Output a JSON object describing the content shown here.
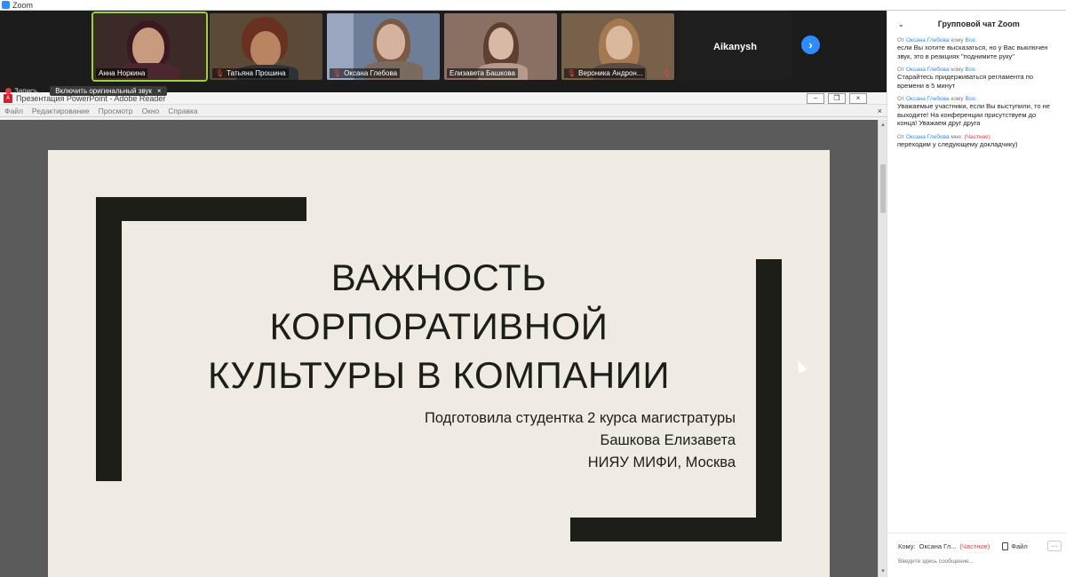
{
  "window": {
    "title": "Zoom"
  },
  "participants": [
    {
      "name": "Анна Норкина",
      "muted": false,
      "skin": "#c89a7e",
      "hair": "#3a1a22",
      "bg": "#3b2a26"
    },
    {
      "name": "Татьяна Прошина",
      "muted": true,
      "skin": "#b98462",
      "hair": "#6a3120",
      "bg": "#5b4a38"
    },
    {
      "name": "Оксана Глебова",
      "muted": true,
      "skin": "#d5b2a0",
      "hair": "#7a5a44",
      "bg": "#6f7e98"
    },
    {
      "name": "Елизавета Башкова",
      "muted": false,
      "skin": "#d8b9a6",
      "hair": "#5e4030",
      "bg": "#8a6f63"
    },
    {
      "name": "Вероника Андрон...",
      "muted": true,
      "skin": "#d9b89e",
      "hair": "#a47850",
      "bg": "#77614a"
    },
    {
      "name": "Aikanysh",
      "muted": false,
      "text_only": true
    }
  ],
  "recording": {
    "label": "Запись"
  },
  "audio_tip": {
    "label": "Включить оригинальный звук",
    "close": "×"
  },
  "reader": {
    "title": "Презентация PowerPoint - Adobe Reader",
    "menu": [
      "Файл",
      "Редактирование",
      "Просмотр",
      "Окно",
      "Справка"
    ],
    "close_doc": "×",
    "buttons": {
      "minimize": "‒",
      "restore": "❐",
      "close": "×"
    }
  },
  "slide": {
    "title_lines": [
      "ВАЖНОСТЬ",
      "КОРПОРАТИВНОЙ",
      "КУЛЬТУРЫ В КОМПАНИИ"
    ],
    "subtitle_lines": [
      "Подготовила студентка 2 курса магистратуры",
      "Башкова Елизавета",
      "НИЯУ МИФИ, Москва"
    ]
  },
  "chat": {
    "title": "Групповой чат Zoom",
    "messages": [
      {
        "from_prefix": "От",
        "from": "Оксана Глебова",
        "to_prefix": "кому",
        "to": "Все:",
        "private": false,
        "text": "если Вы хотите высказаться, но у Вас выключен звук, это в реакциях \"поднимите руку\""
      },
      {
        "from_prefix": "От",
        "from": "Оксана Глебова",
        "to_prefix": "кому",
        "to": "Все:",
        "private": false,
        "text": "Старайтесь придерживаться регламента по времени в 5 минут"
      },
      {
        "from_prefix": "От",
        "from": "Оксана Глебова",
        "to_prefix": "кому",
        "to": "Все:",
        "private": false,
        "text": "Уважаемые участники, если Вы выступили, то не выходите! На конференции присутствуем до конца! Уважаем друг друга"
      },
      {
        "from_prefix": "От",
        "from": "Оксана Глебова",
        "to_prefix": "мне:",
        "to": "(Частное)",
        "private": true,
        "text": "переходим у следующему докладчику)"
      }
    ],
    "to_label": "Кому:",
    "to_value": "Оксана Гл...",
    "private_label": "(Частное)",
    "file_label": "Файл",
    "more": "···",
    "input_placeholder": "Введите здесь сообщение..."
  }
}
